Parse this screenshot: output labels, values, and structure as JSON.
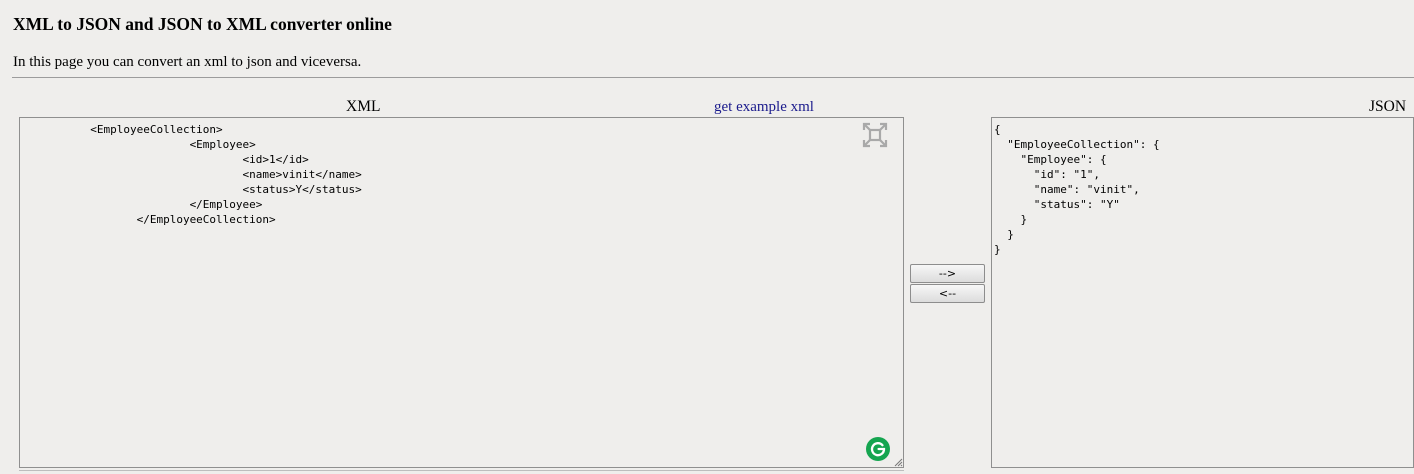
{
  "header": {
    "title": "XML to JSON and JSON to XML converter online",
    "intro": "In this page you can convert an xml to json and viceversa."
  },
  "xml_panel": {
    "label": "XML",
    "example_link": "get example xml",
    "content": "          <EmployeeCollection>\n                         <Employee>\n                                 <id>1</id>\n                                 <name>vinit</name>\n                                 <status>Y</status>\n                         </Employee>\n                 </EmployeeCollection>"
  },
  "json_panel": {
    "label": "JSON",
    "content": "{\n  \"EmployeeCollection\": {\n    \"Employee\": {\n      \"id\": \"1\",\n      \"name\": \"vinit\",\n      \"status\": \"Y\"\n    }\n  }\n}"
  },
  "buttons": {
    "to_json": "-->",
    "to_xml": "<--"
  },
  "icons": {
    "expand": "expand-icon",
    "grammarly": "grammarly-icon"
  },
  "colors": {
    "background": "#efeeec",
    "link": "#1a1a8c",
    "grammarly_green": "#15a550"
  }
}
